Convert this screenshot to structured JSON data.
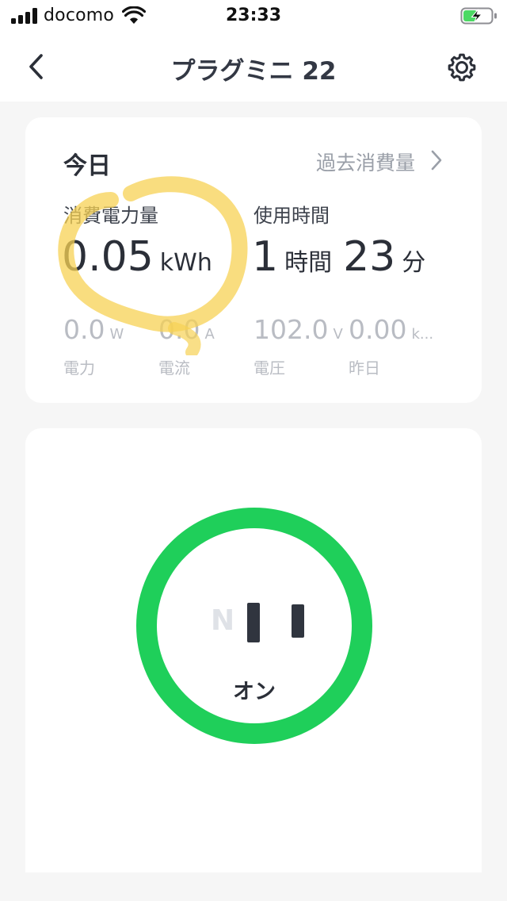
{
  "status_bar": {
    "carrier": "docomo",
    "time": "23:33",
    "signal_bars": 4,
    "battery_level": 0.5,
    "battery_color": "#4cd964"
  },
  "nav": {
    "title": "プラグミニ 22",
    "back_icon": "chevron-left-icon",
    "settings_icon": "gear-icon"
  },
  "energy": {
    "section_title": "今日",
    "history_link": "過去消費量",
    "consumption_label": "消費電力量",
    "consumption_value": "0.05",
    "consumption_unit": "kWh",
    "usage_label": "使用時間",
    "usage_hours": "1",
    "usage_hours_unit": "時間",
    "usage_minutes": "23",
    "usage_minutes_unit": "分",
    "metrics": [
      {
        "value": "0.0",
        "unit": "W",
        "label": "電力"
      },
      {
        "value": "0.0",
        "unit": "A",
        "label": "電流"
      },
      {
        "value": "102.0",
        "unit": "V",
        "label": "電圧"
      },
      {
        "value": "0.00",
        "unit": "k...",
        "label": "昨日"
      }
    ],
    "highlight_color": "#f7d154"
  },
  "plug": {
    "neutral_letter": "N",
    "state": "オン",
    "ring_color": "#1fcf5a"
  }
}
